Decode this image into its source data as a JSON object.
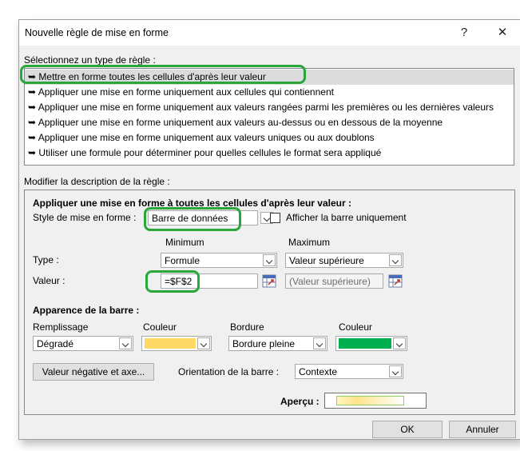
{
  "dialog": {
    "title": "Nouvelle règle de mise en forme",
    "help_glyph": "?",
    "close_glyph": "✕"
  },
  "rule_type": {
    "label": "Sélectionnez un type de règle :",
    "bullet": "➥",
    "items": [
      "Mettre en forme toutes les cellules d'après leur valeur",
      "Appliquer une mise en forme uniquement aux cellules qui contiennent",
      "Appliquer une mise en forme uniquement aux valeurs rangées parmi les premières ou les dernières valeurs",
      "Appliquer une mise en forme uniquement aux valeurs au-dessus ou en dessous de la moyenne",
      "Appliquer une mise en forme uniquement aux valeurs uniques ou aux doublons",
      "Utiliser une formule pour déterminer pour quelles cellules le format sera appliqué"
    ],
    "selected_index": 0
  },
  "description": {
    "label": "Modifier la description de la règle :",
    "heading": "Appliquer une mise en forme à toutes les cellules d'après leur valeur :",
    "style_label": "Style de mise en forme :",
    "style_value": "Barre de données",
    "show_bar_only_label": "Afficher la barre uniquement",
    "show_bar_only_checked": false,
    "minimum_header": "Minimum",
    "maximum_header": "Maximum",
    "type_label": "Type :",
    "min_type": "Formule",
    "max_type": "Valeur supérieure",
    "value_label": "Valeur :",
    "min_value": "=$F$2",
    "max_value": "(Valeur supérieure)"
  },
  "bar_appearance": {
    "heading": "Apparence de la barre :",
    "fill_label": "Remplissage",
    "fill_value": "Dégradé",
    "fill_color_label": "Couleur",
    "fill_color": "#ffd966",
    "border_label": "Bordure",
    "border_value": "Bordure pleine",
    "border_color_label": "Couleur",
    "border_color": "#00b050",
    "negative_axis_button": "Valeur négative et axe...",
    "orientation_label": "Orientation de la barre :",
    "orientation_value": "Contexte",
    "preview_label": "Aperçu :"
  },
  "footer": {
    "ok": "OK",
    "cancel": "Annuler"
  },
  "highlight_color": "#2aa63a"
}
